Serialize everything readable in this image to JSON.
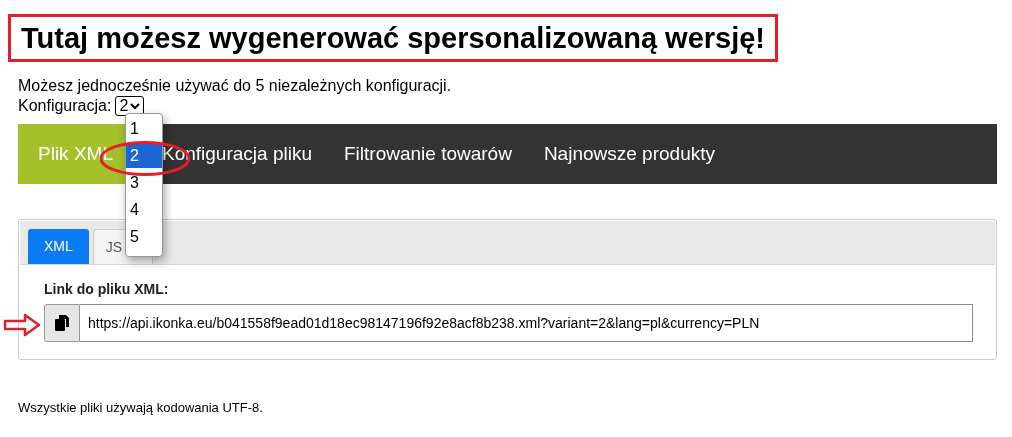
{
  "heading": "Tutaj możesz wygenerować spersonalizowaną wersję!",
  "intro": "Możesz jednocześnie używać do 5 niezależnych konfiguracji.",
  "config": {
    "label": "Konfiguracja:",
    "value": "2",
    "expanded": true,
    "options": [
      {
        "label": "1",
        "selected": false
      },
      {
        "label": "2",
        "selected": true
      },
      {
        "label": "3",
        "selected": false
      },
      {
        "label": "4",
        "selected": false
      },
      {
        "label": "5",
        "selected": false
      }
    ]
  },
  "nav": [
    {
      "label": "Plik XML",
      "selected": true
    },
    {
      "label": "Konfiguracja pliku",
      "selected": false
    },
    {
      "label": "Filtrowanie towarów",
      "selected": false
    },
    {
      "label": "Najnowsze produkty",
      "selected": false
    }
  ],
  "tabs": [
    {
      "label": "XML",
      "selected": true
    },
    {
      "label": "JS",
      "selected": false
    }
  ],
  "link_label": "Link do pliku XML:",
  "link_value": "https://api.ikonka.eu/b041558f9ead01d18ec98147196f92e8acf8b238.xml?variant=2&lang=pl&currency=PLN",
  "footer": "Wszystkie pliki używają kodowania UTF-8.",
  "annotations": [
    {
      "kind": "frame"
    },
    {
      "kind": "ellipse"
    },
    {
      "kind": "arrow"
    }
  ]
}
